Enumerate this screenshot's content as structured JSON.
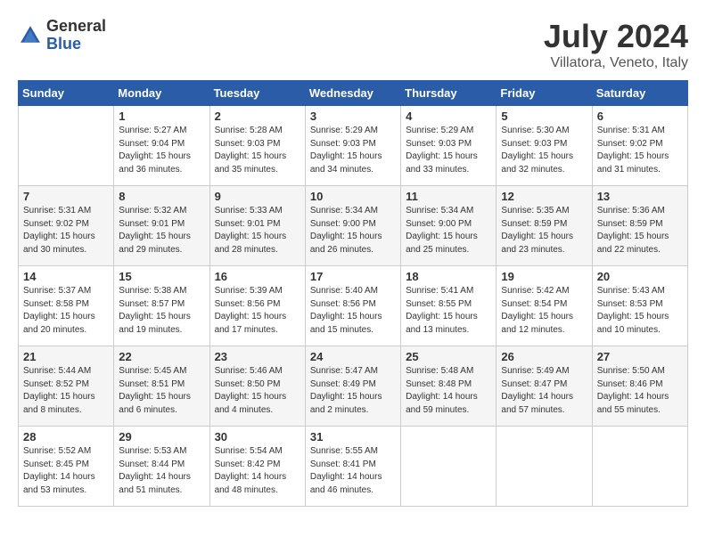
{
  "logo": {
    "general": "General",
    "blue": "Blue"
  },
  "title": "July 2024",
  "subtitle": "Villatora, Veneto, Italy",
  "days_of_week": [
    "Sunday",
    "Monday",
    "Tuesday",
    "Wednesday",
    "Thursday",
    "Friday",
    "Saturday"
  ],
  "weeks": [
    [
      {
        "day": "",
        "info": ""
      },
      {
        "day": "1",
        "info": "Sunrise: 5:27 AM\nSunset: 9:04 PM\nDaylight: 15 hours\nand 36 minutes."
      },
      {
        "day": "2",
        "info": "Sunrise: 5:28 AM\nSunset: 9:03 PM\nDaylight: 15 hours\nand 35 minutes."
      },
      {
        "day": "3",
        "info": "Sunrise: 5:29 AM\nSunset: 9:03 PM\nDaylight: 15 hours\nand 34 minutes."
      },
      {
        "day": "4",
        "info": "Sunrise: 5:29 AM\nSunset: 9:03 PM\nDaylight: 15 hours\nand 33 minutes."
      },
      {
        "day": "5",
        "info": "Sunrise: 5:30 AM\nSunset: 9:03 PM\nDaylight: 15 hours\nand 32 minutes."
      },
      {
        "day": "6",
        "info": "Sunrise: 5:31 AM\nSunset: 9:02 PM\nDaylight: 15 hours\nand 31 minutes."
      }
    ],
    [
      {
        "day": "7",
        "info": "Sunrise: 5:31 AM\nSunset: 9:02 PM\nDaylight: 15 hours\nand 30 minutes."
      },
      {
        "day": "8",
        "info": "Sunrise: 5:32 AM\nSunset: 9:01 PM\nDaylight: 15 hours\nand 29 minutes."
      },
      {
        "day": "9",
        "info": "Sunrise: 5:33 AM\nSunset: 9:01 PM\nDaylight: 15 hours\nand 28 minutes."
      },
      {
        "day": "10",
        "info": "Sunrise: 5:34 AM\nSunset: 9:00 PM\nDaylight: 15 hours\nand 26 minutes."
      },
      {
        "day": "11",
        "info": "Sunrise: 5:34 AM\nSunset: 9:00 PM\nDaylight: 15 hours\nand 25 minutes."
      },
      {
        "day": "12",
        "info": "Sunrise: 5:35 AM\nSunset: 8:59 PM\nDaylight: 15 hours\nand 23 minutes."
      },
      {
        "day": "13",
        "info": "Sunrise: 5:36 AM\nSunset: 8:59 PM\nDaylight: 15 hours\nand 22 minutes."
      }
    ],
    [
      {
        "day": "14",
        "info": "Sunrise: 5:37 AM\nSunset: 8:58 PM\nDaylight: 15 hours\nand 20 minutes."
      },
      {
        "day": "15",
        "info": "Sunrise: 5:38 AM\nSunset: 8:57 PM\nDaylight: 15 hours\nand 19 minutes."
      },
      {
        "day": "16",
        "info": "Sunrise: 5:39 AM\nSunset: 8:56 PM\nDaylight: 15 hours\nand 17 minutes."
      },
      {
        "day": "17",
        "info": "Sunrise: 5:40 AM\nSunset: 8:56 PM\nDaylight: 15 hours\nand 15 minutes."
      },
      {
        "day": "18",
        "info": "Sunrise: 5:41 AM\nSunset: 8:55 PM\nDaylight: 15 hours\nand 13 minutes."
      },
      {
        "day": "19",
        "info": "Sunrise: 5:42 AM\nSunset: 8:54 PM\nDaylight: 15 hours\nand 12 minutes."
      },
      {
        "day": "20",
        "info": "Sunrise: 5:43 AM\nSunset: 8:53 PM\nDaylight: 15 hours\nand 10 minutes."
      }
    ],
    [
      {
        "day": "21",
        "info": "Sunrise: 5:44 AM\nSunset: 8:52 PM\nDaylight: 15 hours\nand 8 minutes."
      },
      {
        "day": "22",
        "info": "Sunrise: 5:45 AM\nSunset: 8:51 PM\nDaylight: 15 hours\nand 6 minutes."
      },
      {
        "day": "23",
        "info": "Sunrise: 5:46 AM\nSunset: 8:50 PM\nDaylight: 15 hours\nand 4 minutes."
      },
      {
        "day": "24",
        "info": "Sunrise: 5:47 AM\nSunset: 8:49 PM\nDaylight: 15 hours\nand 2 minutes."
      },
      {
        "day": "25",
        "info": "Sunrise: 5:48 AM\nSunset: 8:48 PM\nDaylight: 14 hours\nand 59 minutes."
      },
      {
        "day": "26",
        "info": "Sunrise: 5:49 AM\nSunset: 8:47 PM\nDaylight: 14 hours\nand 57 minutes."
      },
      {
        "day": "27",
        "info": "Sunrise: 5:50 AM\nSunset: 8:46 PM\nDaylight: 14 hours\nand 55 minutes."
      }
    ],
    [
      {
        "day": "28",
        "info": "Sunrise: 5:52 AM\nSunset: 8:45 PM\nDaylight: 14 hours\nand 53 minutes."
      },
      {
        "day": "29",
        "info": "Sunrise: 5:53 AM\nSunset: 8:44 PM\nDaylight: 14 hours\nand 51 minutes."
      },
      {
        "day": "30",
        "info": "Sunrise: 5:54 AM\nSunset: 8:42 PM\nDaylight: 14 hours\nand 48 minutes."
      },
      {
        "day": "31",
        "info": "Sunrise: 5:55 AM\nSunset: 8:41 PM\nDaylight: 14 hours\nand 46 minutes."
      },
      {
        "day": "",
        "info": ""
      },
      {
        "day": "",
        "info": ""
      },
      {
        "day": "",
        "info": ""
      }
    ]
  ]
}
